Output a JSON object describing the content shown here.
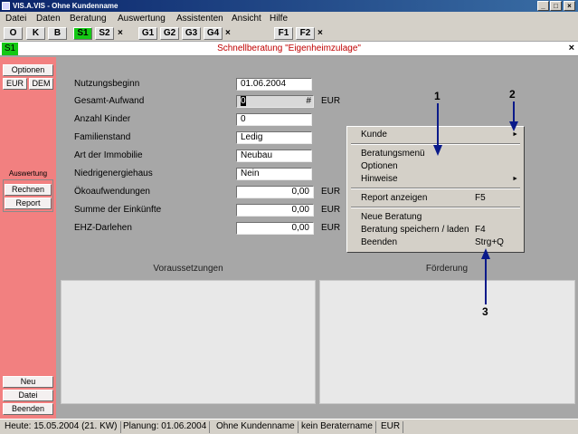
{
  "window": {
    "title": "VIS.A.VIS - Ohne Kundenname",
    "min_glyph": "_",
    "max_glyph": "□",
    "close_glyph": "×"
  },
  "menu": [
    "Datei",
    "Daten",
    "Beratung",
    "Auswertung",
    "Assistenten",
    "Ansicht",
    "Hilfe"
  ],
  "toolbar": {
    "buttons": [
      "O",
      "K",
      "B",
      "S1",
      "S2",
      "G1",
      "G2",
      "G3",
      "G4",
      "F1",
      "F2"
    ],
    "close_glyph": "×"
  },
  "heading": {
    "tag": "S1",
    "title": "Schnellberatung \"Eigenheimzulage\"",
    "close_glyph": "×"
  },
  "sidebar": {
    "optionen": "Optionen",
    "eur": "EUR",
    "dem": "DEM",
    "auswertung_label": "Auswertung",
    "rechnen": "Rechnen",
    "report": "Report",
    "neu": "Neu",
    "datei": "Datei",
    "beenden": "Beenden"
  },
  "form": {
    "fields": [
      {
        "label": "Nutzungsbeginn",
        "value": "01.06.2004",
        "unit": ""
      },
      {
        "label": "Gesamt-Aufwand",
        "value": "0",
        "unit": "EUR",
        "suffix": "#"
      },
      {
        "label": "Anzahl Kinder",
        "value": "0",
        "unit": ""
      },
      {
        "label": "Familienstand",
        "value": "Ledig",
        "unit": ""
      },
      {
        "label": "Art der Immobilie",
        "value": "Neubau",
        "unit": ""
      },
      {
        "label": "Niedrigenergiehaus",
        "value": "Nein",
        "unit": ""
      },
      {
        "label": "Ökoaufwendungen",
        "value": "0,00",
        "unit": "EUR"
      },
      {
        "label": "Summe der Einkünfte",
        "value": "0,00",
        "unit": "EUR"
      },
      {
        "label": "EHZ-Darlehen",
        "value": "0,00",
        "unit": "EUR"
      }
    ]
  },
  "panels": {
    "left_title": "Voraussetzungen",
    "right_title": "Förderung"
  },
  "context_menu": {
    "kunde": "Kunde",
    "beratungsmenue": "Beratungsmenü",
    "optionen": "Optionen",
    "hinweise": "Hinweise",
    "report_anzeigen": "Report anzeigen",
    "report_key": "F5",
    "neue_beratung": "Neue Beratung",
    "speichern": "Beratung speichern / laden",
    "speichern_key": "F4",
    "beenden": "Beenden",
    "beenden_key": "Strg+Q",
    "submenu_glyph": "►"
  },
  "callouts": [
    "1",
    "2",
    "3"
  ],
  "colors": {
    "arrow": "#0a1a8a",
    "heading_title": "#c00000",
    "green": "#14c814",
    "sidebar": "#f28080"
  },
  "statusbar": [
    "Heute: 15.05.2004 (21. KW)",
    "Planung: 01.06.2004",
    "Ohne Kundenname",
    "kein Beratername",
    "EUR"
  ]
}
